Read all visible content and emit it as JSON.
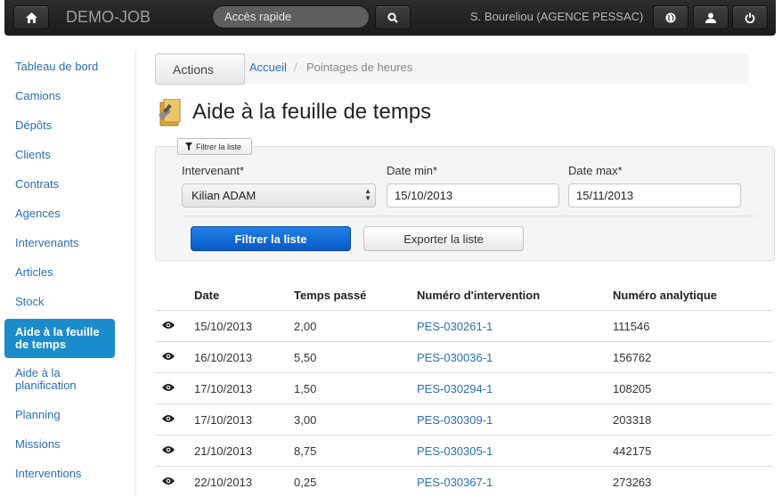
{
  "header": {
    "brand": "DEMO-JOB",
    "search_placeholder": "Accès rapide",
    "user": "S. Boureliou (AGENCE PESSAC)"
  },
  "sidebar": {
    "items": [
      {
        "label": "Tableau de bord"
      },
      {
        "label": "Camions"
      },
      {
        "label": "Dépôts"
      },
      {
        "label": "Clients"
      },
      {
        "label": "Contrats"
      },
      {
        "label": "Agences"
      },
      {
        "label": "Intervenants"
      },
      {
        "label": "Articles"
      },
      {
        "label": "Stock"
      },
      {
        "label": "Aide à la feuille de temps"
      },
      {
        "label": "Aide à la planification"
      },
      {
        "label": "Planning"
      },
      {
        "label": "Missions"
      },
      {
        "label": "Interventions"
      }
    ]
  },
  "breadcrumb": {
    "actions_label": "Actions",
    "home": "Accueil",
    "separator": "/",
    "current": "Pointages de heures"
  },
  "page": {
    "title": "Aide à la feuille de temps"
  },
  "filter": {
    "toggle_label": "Filtrer la liste",
    "intervenant_label": "Intervenant*",
    "intervenant_value": "Kilian ADAM",
    "date_min_label": "Date min*",
    "date_min_value": "15/10/2013",
    "date_max_label": "Date max*",
    "date_max_value": "15/11/2013",
    "submit_label": "Filtrer la liste",
    "export_label": "Exporter la liste"
  },
  "table": {
    "headers": [
      "Date",
      "Temps passé",
      "Numéro d'intervention",
      "Numéro analytique"
    ],
    "rows": [
      {
        "date": "15/10/2013",
        "temps": "2,00",
        "intervention": "PES-030261-1",
        "analytique": "111546"
      },
      {
        "date": "16/10/2013",
        "temps": "5,50",
        "intervention": "PES-030036-1",
        "analytique": "156762"
      },
      {
        "date": "17/10/2013",
        "temps": "1,50",
        "intervention": "PES-030294-1",
        "analytique": "108205"
      },
      {
        "date": "17/10/2013",
        "temps": "3,00",
        "intervention": "PES-030309-1",
        "analytique": "203318"
      },
      {
        "date": "21/10/2013",
        "temps": "8,75",
        "intervention": "PES-030305-1",
        "analytique": "442175"
      },
      {
        "date": "22/10/2013",
        "temps": "0,25",
        "intervention": "PES-030367-1",
        "analytique": "273263"
      }
    ]
  }
}
